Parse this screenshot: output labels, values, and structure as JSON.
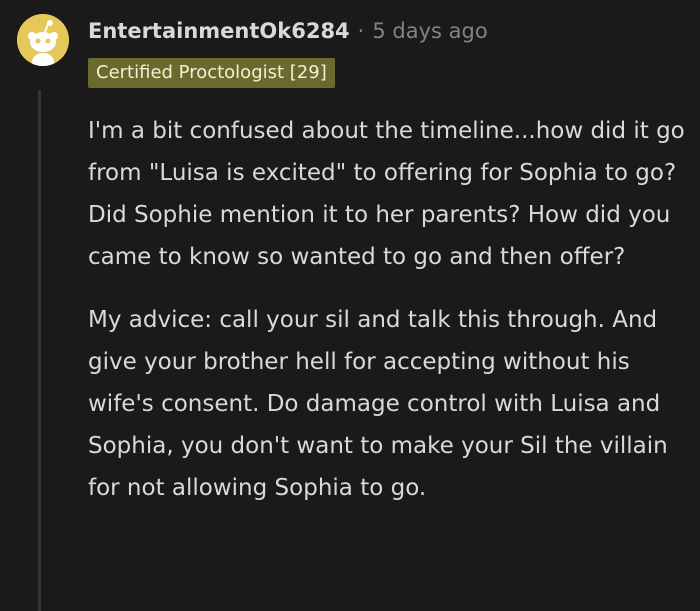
{
  "comment": {
    "author": "EntertainmentOk6284",
    "separator": "·",
    "timestamp": "5 days ago",
    "flair": "Certified Proctologist [29]",
    "paragraphs": [
      "I'm a bit confused about the timeline...how did it go from \"Luisa is excited\" to offering for Sophia to go? Did Sophie mention it to her parents? How did you came to know so wanted to go and then offer?",
      "My advice: call your sil and talk this through. And give your brother hell for accepting without his wife's consent. Do damage control with Luisa and Sophia, you don't want to make your Sil the villain for not allowing Sophia to go."
    ]
  },
  "colors": {
    "background": "#1a1a1b",
    "text": "#d7dadc",
    "meta": "#818384",
    "flair_bg": "#6b6a2e",
    "avatar_bg": "#e6c85a"
  },
  "icons": {
    "avatar": "snoo-avatar-icon"
  }
}
